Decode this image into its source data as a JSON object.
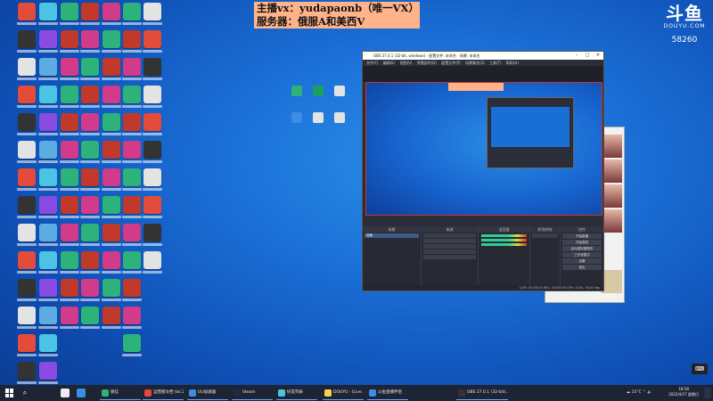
{
  "banner": {
    "line1": "主播vx：yudapaonb（唯一VX）",
    "line2": "服务器：俄服A和美西V"
  },
  "watermark": {
    "logo": "斗鱼",
    "site": "DOUYU.COM",
    "room_number": "58260"
  },
  "obs": {
    "title": "OBS 27.0.1 (32-bit, windows) - 配置文件: 未命名 - 场景: 未命名",
    "menu": "文件(F) 编辑(E) 视图(V) 停靠部件(D) 配置文件(P) 场景集合(S) 工具(T) 帮助(H)",
    "panels": {
      "scenes": "场景",
      "sources": "来源",
      "mixer": "混音器",
      "transitions": "转场特效",
      "controls": "控件"
    },
    "scene_item": "场景",
    "controls": [
      "开始直播",
      "开始录制",
      "启动虚拟摄像机",
      "工作室模式",
      "设置",
      "退出"
    ],
    "status": "LIVE: 00:00:00  REC: 00:00:00  CPU: 4.5%, 30.00 fps"
  },
  "taskbar": {
    "start_icon": "windows-start-icon",
    "search_icon": "search-icon",
    "items": [
      {
        "label": "微信"
      },
      {
        "label": "运营部文档 Vol.2"
      },
      {
        "label": "UU加速器"
      },
      {
        "label": "Steam"
      },
      {
        "label": "好友列表"
      },
      {
        "label": "DOUYU - [Live..."
      },
      {
        "label": "斗鱼直播伴侣"
      },
      {
        "label": "OBS 27.0.1 (32-bit)..."
      }
    ],
    "temperature": "15°C",
    "clock_time": "18:58",
    "clock_date": "2022/4/17 星期日"
  }
}
